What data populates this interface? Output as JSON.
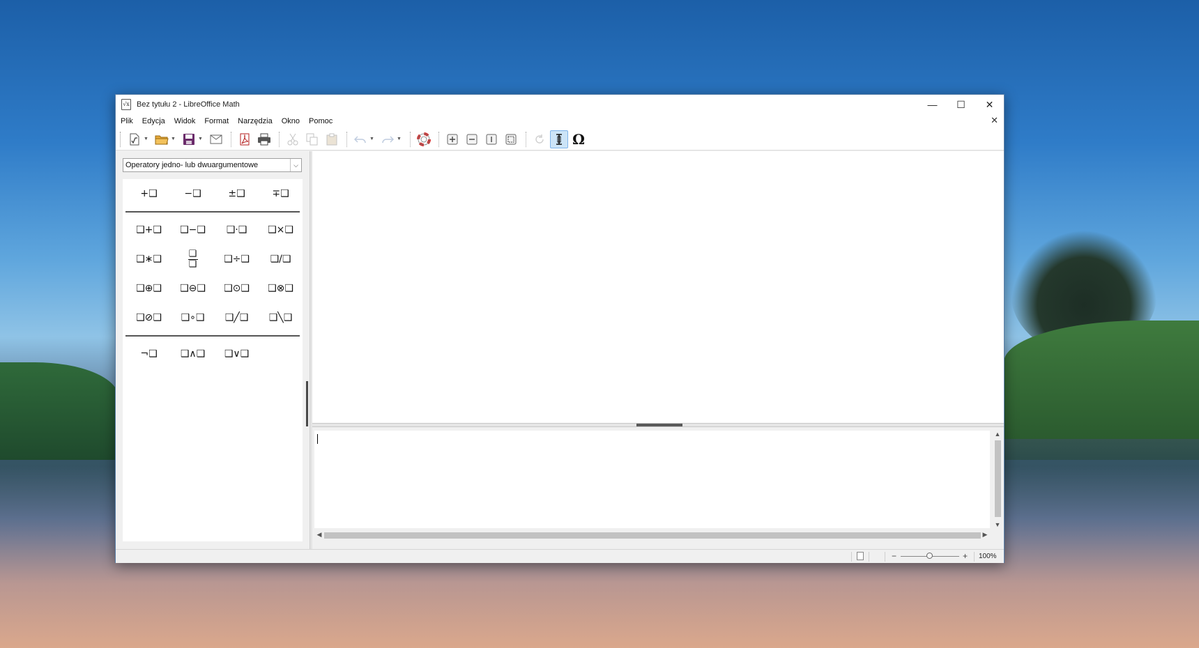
{
  "window": {
    "title": "Bez tytułu 2 - LibreOffice Math",
    "app_icon_glyph": "√x",
    "controls": {
      "minimize": "—",
      "maximize": "☐",
      "close": "✕"
    }
  },
  "menu": {
    "items": [
      {
        "label": "Plik",
        "name": "menu-plik"
      },
      {
        "label": "Edycja",
        "name": "menu-edycja"
      },
      {
        "label": "Widok",
        "name": "menu-widok"
      },
      {
        "label": "Format",
        "name": "menu-format"
      },
      {
        "label": "Narzędzia",
        "name": "menu-narzedzia"
      },
      {
        "label": "Okno",
        "name": "menu-okno"
      },
      {
        "label": "Pomoc",
        "name": "menu-pomoc"
      }
    ],
    "doc_close": "✕"
  },
  "toolbar": {
    "icons": [
      "new-icon",
      "open-icon",
      "save-icon",
      "email-icon",
      "export-pdf-icon",
      "print-icon",
      "cut-icon",
      "copy-icon",
      "paste-icon",
      "undo-icon",
      "redo-icon",
      "help-icon",
      "zoom-in-icon",
      "zoom-out-icon",
      "zoom-100-icon",
      "show-all-icon",
      "update-icon",
      "formula-cursor-icon",
      "symbols-icon"
    ],
    "symbols_glyph": "Ω"
  },
  "elements_panel": {
    "category": "Operatory jedno- lub dwuargumentowe",
    "dropdown_arrow": "⌵",
    "unary": [
      "+❑",
      "−❑",
      "±❑",
      "∓❑"
    ],
    "binary": [
      [
        "❑+❑",
        "❑−❑",
        "❑·❑",
        "❑×❑"
      ],
      [
        "❑∗❑",
        "frac",
        "❑÷❑",
        "❑/❑"
      ],
      [
        "❑⊕❑",
        "❑⊖❑",
        "❑⊙❑",
        "❑⊗❑"
      ],
      [
        "❑⊘❑",
        "❑∘❑",
        "❑╱❑",
        "❑╲❑"
      ]
    ],
    "frac_top": "❑",
    "frac_bottom": "❑",
    "logic": [
      "¬❑",
      "❑∧❑",
      "❑∨❑"
    ]
  },
  "editor": {
    "text": "",
    "scroll_up": "▲",
    "scroll_down": "▼",
    "scroll_left": "◀",
    "scroll_right": "▶"
  },
  "statusbar": {
    "zoom_minus": "−",
    "zoom_plus": "+",
    "zoom": "100%"
  }
}
